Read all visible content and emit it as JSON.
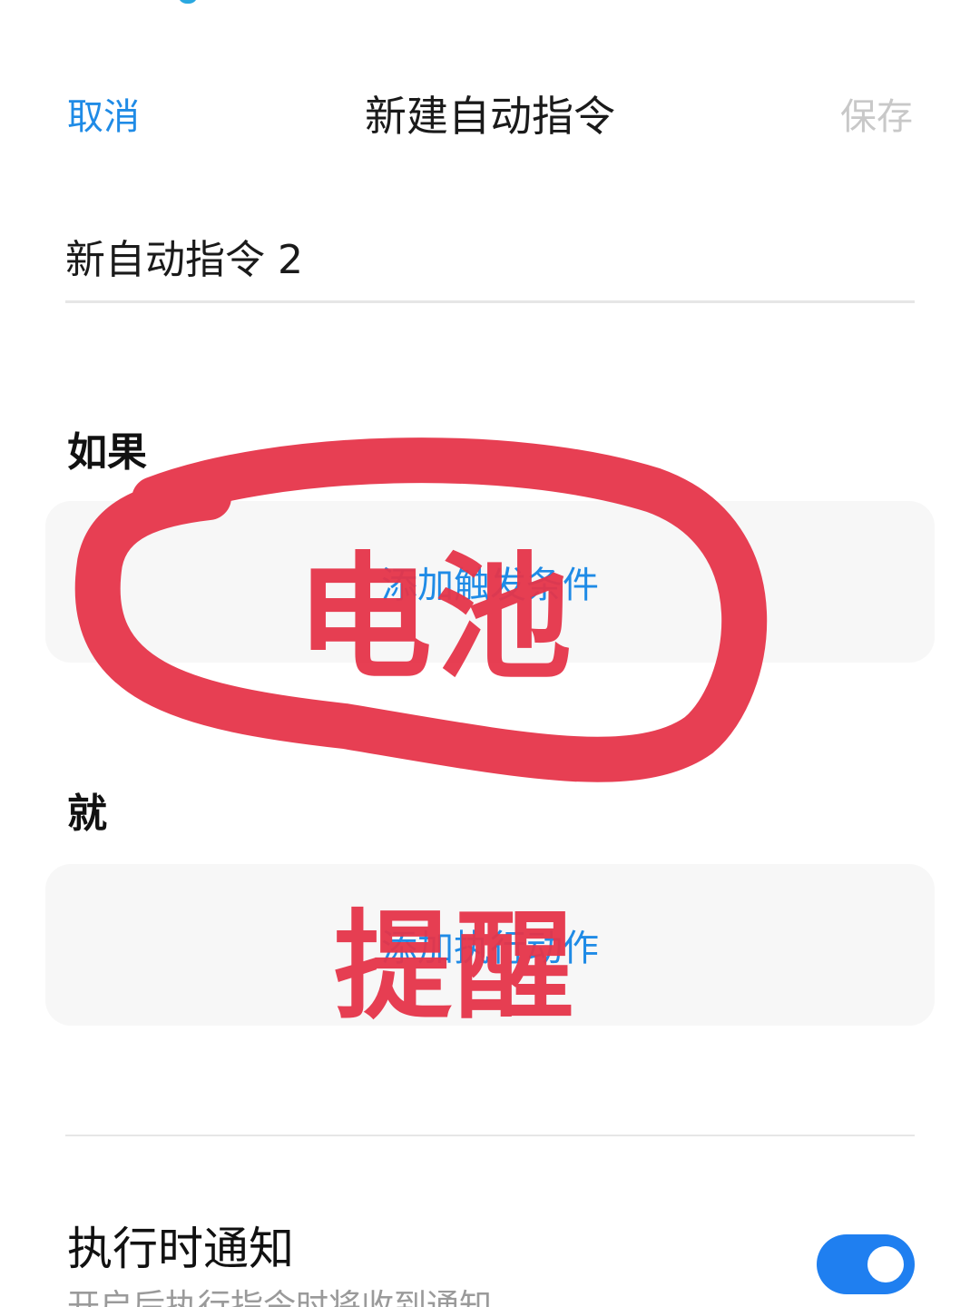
{
  "header": {
    "cancel_label": "取消",
    "title": "新建自动指令",
    "save_label": "保存"
  },
  "name_field": {
    "value": "新自动指令 2"
  },
  "if_section": {
    "label": "如果",
    "add_label": "添加触发条件"
  },
  "then_section": {
    "label": "就",
    "add_label": "添加执行动作"
  },
  "notify": {
    "title": "执行时通知",
    "subtitle": "开启后执行指令时将收到通知",
    "enabled": true
  },
  "annotations": {
    "battery": "电池",
    "remind": "提醒"
  },
  "colors": {
    "accent": "#1f8be6",
    "toggle_on": "#1f7ff0",
    "annotation_red": "#e6354a",
    "disabled_text": "#c8c8c8"
  }
}
